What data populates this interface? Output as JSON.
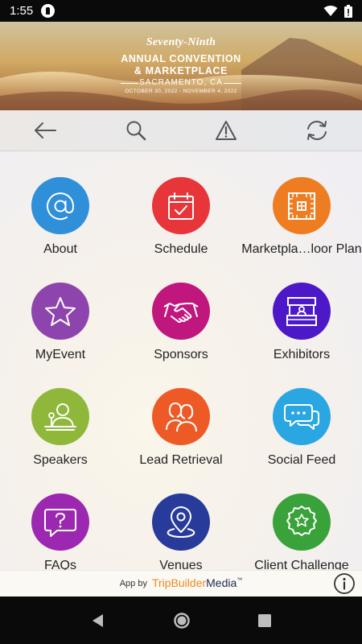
{
  "status_bar": {
    "time": "1:55"
  },
  "banner": {
    "line1": "Seventy-Ninth",
    "line2": "ANNUAL CONVENTION",
    "line3": "& MARKETPLACE",
    "location": "SACRAMENTO, CA",
    "dates": "OCTOBER 30, 2022 - NOVEMBER 4, 2022"
  },
  "toolbar": {
    "back_icon": "arrow-left-icon",
    "search_icon": "search-icon",
    "alert_icon": "warning-icon",
    "sync_icon": "refresh-icon"
  },
  "tiles": [
    {
      "label": "About",
      "color": "#2f8fd8",
      "icon": "at-icon"
    },
    {
      "label": "Schedule",
      "color": "#e8353a",
      "icon": "calendar-icon"
    },
    {
      "label": "Marketpla…loor Plan",
      "color": "#ee7d22",
      "icon": "floor-plan-icon"
    },
    {
      "label": "MyEvent",
      "color": "#8e44ad",
      "icon": "star-icon"
    },
    {
      "label": "Sponsors",
      "color": "#c0177f",
      "icon": "handshake-icon"
    },
    {
      "label": "Exhibitors",
      "color": "#4d19c8",
      "icon": "booth-icon"
    },
    {
      "label": "Speakers",
      "color": "#8fb83a",
      "icon": "speaker-icon"
    },
    {
      "label": "Lead Retrieval",
      "color": "#ee5a26",
      "icon": "people-icon"
    },
    {
      "label": "Social Feed",
      "color": "#2aa7e2",
      "icon": "chat-icon"
    },
    {
      "label": "FAQs",
      "color": "#9c27b0",
      "icon": "question-icon"
    },
    {
      "label": "Venues",
      "color": "#283b9a",
      "icon": "map-pin-icon"
    },
    {
      "label": "Client Challenge",
      "color": "#3aa23a",
      "icon": "award-icon"
    }
  ],
  "footer": {
    "prefix": "App by",
    "brand_part1": "TripBuilder",
    "brand_part2": "Media",
    "trademark": "™"
  },
  "nav": {
    "back": "nav-back-icon",
    "home": "nav-home-icon",
    "recents": "nav-recents-icon"
  }
}
